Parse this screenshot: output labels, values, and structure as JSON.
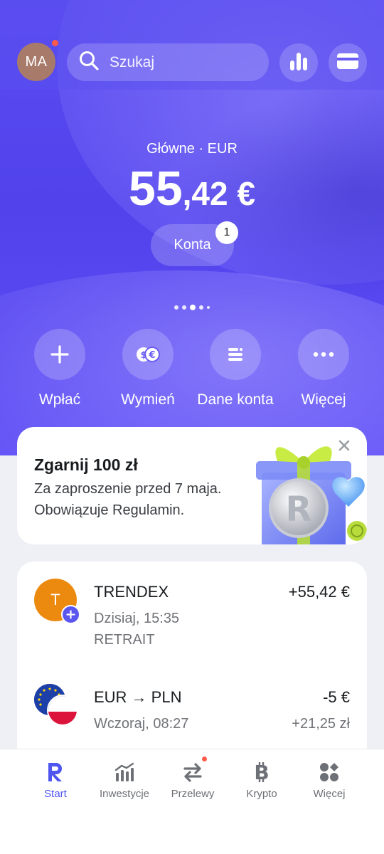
{
  "header": {
    "avatar_initials": "MA",
    "search_placeholder": "Szukaj",
    "buttons": [
      "analytics-icon",
      "card-icon"
    ]
  },
  "account": {
    "label": "Główne · EUR",
    "balance_main": "55",
    "balance_cents": ",42 €",
    "accounts_button": "Konta",
    "accounts_badge": "1"
  },
  "actions": [
    {
      "label": "Wpłać",
      "icon": "plus-icon"
    },
    {
      "label": "Wymień",
      "icon": "exchange-icon"
    },
    {
      "label": "Dane konta",
      "icon": "details-icon"
    },
    {
      "label": "Więcej",
      "icon": "more-icon"
    }
  ],
  "promo": {
    "title": "Zgarnij 100 zł",
    "line1": "Za zaproszenie przed 7 maja.",
    "line2": "Obowiązuje Regulamin."
  },
  "transactions": [
    {
      "icon_letter": "T",
      "name": "TRENDEX",
      "date": "Dzisiaj, 15:35",
      "note": "RETRAIT",
      "amount": "+55,42 €"
    },
    {
      "name": "EUR → PLN",
      "date": "Wczoraj, 08:27",
      "amount": "-5 €",
      "amount_secondary": "+21,25 zł"
    }
  ],
  "nav": [
    {
      "label": "Start",
      "icon": "revolut-logo-icon",
      "active": true
    },
    {
      "label": "Inwestycje",
      "icon": "chart-icon"
    },
    {
      "label": "Przelewy",
      "icon": "transfer-icon"
    },
    {
      "label": "Krypto",
      "icon": "bitcoin-icon"
    },
    {
      "label": "Więcej",
      "icon": "grid-icon"
    }
  ],
  "colors": {
    "accent": "#4f55f1",
    "hero": "#5142ec",
    "notification": "#ff5a4a"
  }
}
